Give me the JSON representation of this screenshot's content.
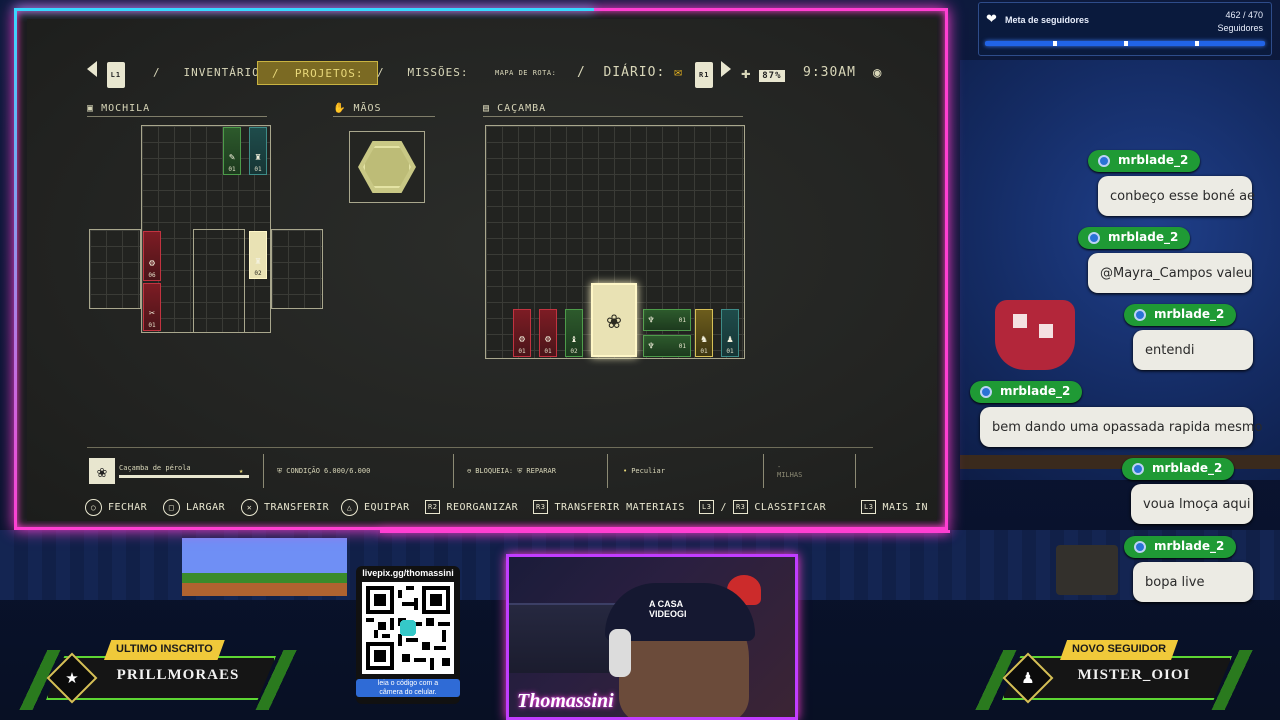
{
  "game": {
    "nav": {
      "l1": "L1",
      "inventario": "INVENTÁRIO:",
      "projetos": "PROJETOS:",
      "missoes": "MISSÕES:",
      "mapa": "MAPA DE ROTA:",
      "diario": "DIÁRIO:",
      "r1": "R1",
      "battery": "87%",
      "time": "9:30AM"
    },
    "sections": {
      "mochila": "MOCHILA",
      "maos": "MÃOS",
      "cacamba": "CAÇAMBA"
    },
    "mochila_items": [
      {
        "color": "green",
        "glyph": "✎",
        "count": "01"
      },
      {
        "color": "teal",
        "glyph": "♜",
        "count": "01"
      },
      {
        "color": "red",
        "glyph": "⚙",
        "count": "06"
      },
      {
        "color": "red",
        "glyph": "✂",
        "count": "01"
      },
      {
        "color": "cream",
        "glyph": "♜",
        "count": "02"
      }
    ],
    "cacamba_items": [
      {
        "color": "red",
        "glyph": "⚙",
        "count": "01"
      },
      {
        "color": "red",
        "glyph": "⚙",
        "count": "01"
      },
      {
        "color": "green",
        "glyph": "♝",
        "count": "02"
      },
      {
        "color": "green",
        "glyph": "♆",
        "count": "01"
      },
      {
        "color": "green",
        "glyph": "♆",
        "count": "01"
      },
      {
        "color": "gold",
        "glyph": "♞",
        "count": "01"
      },
      {
        "color": "teal",
        "glyph": "♟",
        "count": "01"
      }
    ],
    "info": {
      "item_name": "Caçamba de pérola",
      "condicao_label": "CONDIÇÃO",
      "condicao_value": "6.000/6.000",
      "bloqueia": "BLOQUEIA:",
      "reparar": "REPARAR",
      "peculiar": "Peculiar",
      "milhas_dash": "-",
      "milhas": "MILHAS"
    },
    "buttons": {
      "fechar": "FECHAR",
      "largar": "LARGAR",
      "transferir": "TRANSFERIR",
      "equipar": "EQUIPAR",
      "r2": "R2",
      "reorganizar": "REORGANIZAR",
      "r3a": "R3",
      "transferir_materiais": "TRANSFERIR MATERIAIS",
      "l3a": "L3",
      "slash": "/",
      "r3b": "R3",
      "classificar": "CLASSIFICAR",
      "l3b": "L3",
      "mais_info": "MAIS IN"
    }
  },
  "follower_goal": {
    "title": "Meta de seguidores",
    "count": "462 / 470",
    "unit": "Seguidores",
    "progress": 0.983
  },
  "chat": [
    {
      "user": "mrblade_2",
      "text": "conbeço esse boné ae"
    },
    {
      "user": "mrblade_2",
      "text": "@Mayra_Campos valeu"
    },
    {
      "user": "mrblade_2",
      "text": "entendi"
    },
    {
      "user": "mrblade_2",
      "text": "bem dando uma opassada rapida mesmo"
    },
    {
      "user": "mrblade_2",
      "text": "voua lmoça aqui"
    },
    {
      "user": "mrblade_2",
      "text": "bopa live"
    }
  ],
  "last_sub": {
    "label": "ULTIMO INSCRITO",
    "name": "PRILLMORAES"
  },
  "new_follower": {
    "label": "NOVO SEGUIDOR",
    "name": "MISTER_OIOI"
  },
  "qr": {
    "url": "livepix.gg/thomassini",
    "hint_line1": "leia o código com a",
    "hint_line2": "câmera do celular."
  },
  "webcam": {
    "streamer": "Thomassini",
    "cap_line1": "A CASA",
    "cap_line2": "VIDEOGI"
  },
  "colors": {
    "neon_pink": "#ff3fd2",
    "neon_blue": "#38d8ff",
    "chat_green": "#1f9a35",
    "gold": "#f0c93a"
  }
}
